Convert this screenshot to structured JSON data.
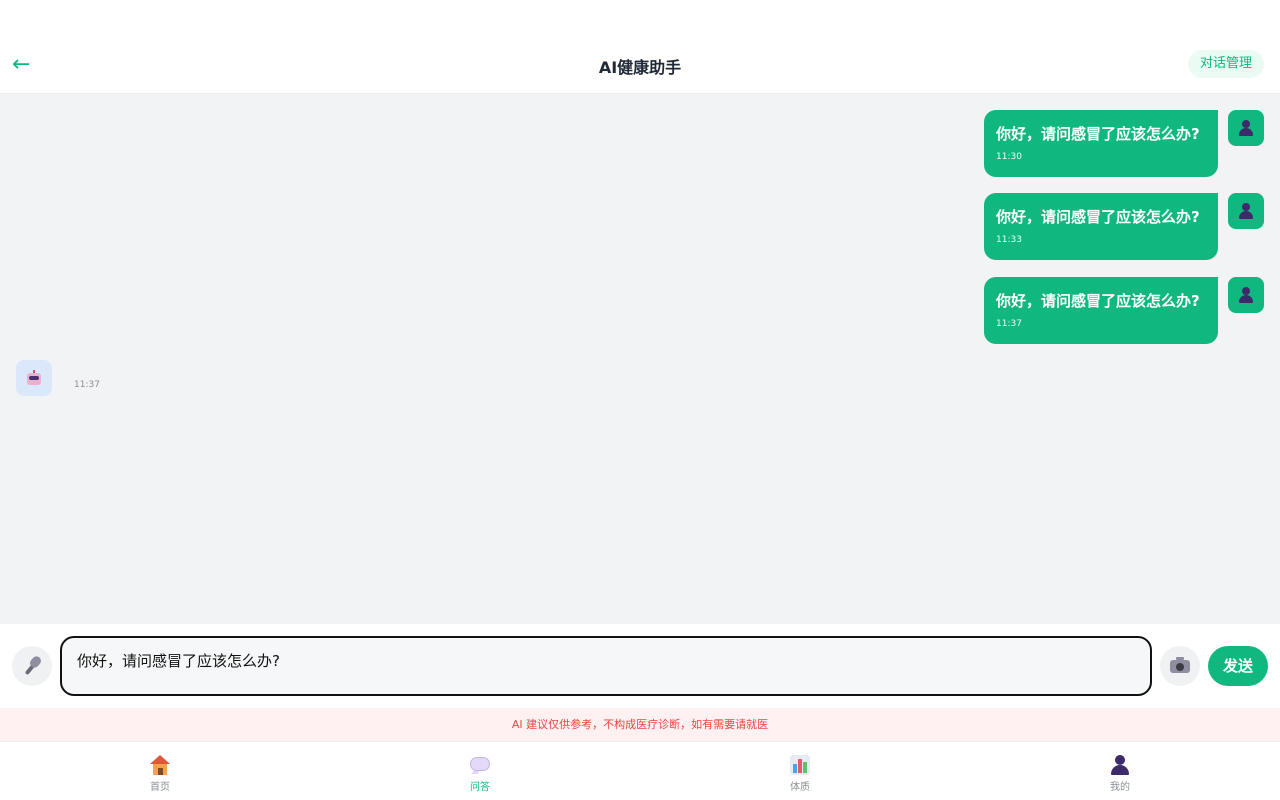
{
  "header": {
    "back_icon": "arrow-left-icon",
    "back_glyph": "←",
    "title": "AI健康助手",
    "manage_label": "对话管理"
  },
  "messages": [
    {
      "role": "user",
      "text": "你好，请问感冒了应该怎么办?",
      "time": "11:30"
    },
    {
      "role": "user",
      "text": "你好，请问感冒了应该怎么办?",
      "time": "11:33"
    },
    {
      "role": "user",
      "text": "你好，请问感冒了应该怎么办?",
      "time": "11:37"
    },
    {
      "role": "ai",
      "text": "",
      "time": "11:37"
    }
  ],
  "composer": {
    "input_value": "你好，请问感冒了应该怎么办?",
    "send_label": "发送",
    "mic_icon": "microphone-icon",
    "camera_icon": "camera-icon"
  },
  "disclaimer": "AI 建议仅供参考，不构成医疗诊断，如有需要请就医",
  "tabbar": {
    "items": [
      {
        "label": "首页",
        "icon": "home-icon",
        "active": false
      },
      {
        "label": "问答",
        "icon": "chat-bubble-icon",
        "active": true
      },
      {
        "label": "体质",
        "icon": "bar-chart-icon",
        "active": false
      },
      {
        "label": "我的",
        "icon": "user-icon",
        "active": false
      }
    ]
  },
  "colors": {
    "accent": "#10b77f",
    "user_bubble": "#10b77f",
    "disclaimer_text": "#ef4444",
    "disclaimer_bg": "#fff1f1",
    "chat_bg": "#f2f3f5"
  }
}
